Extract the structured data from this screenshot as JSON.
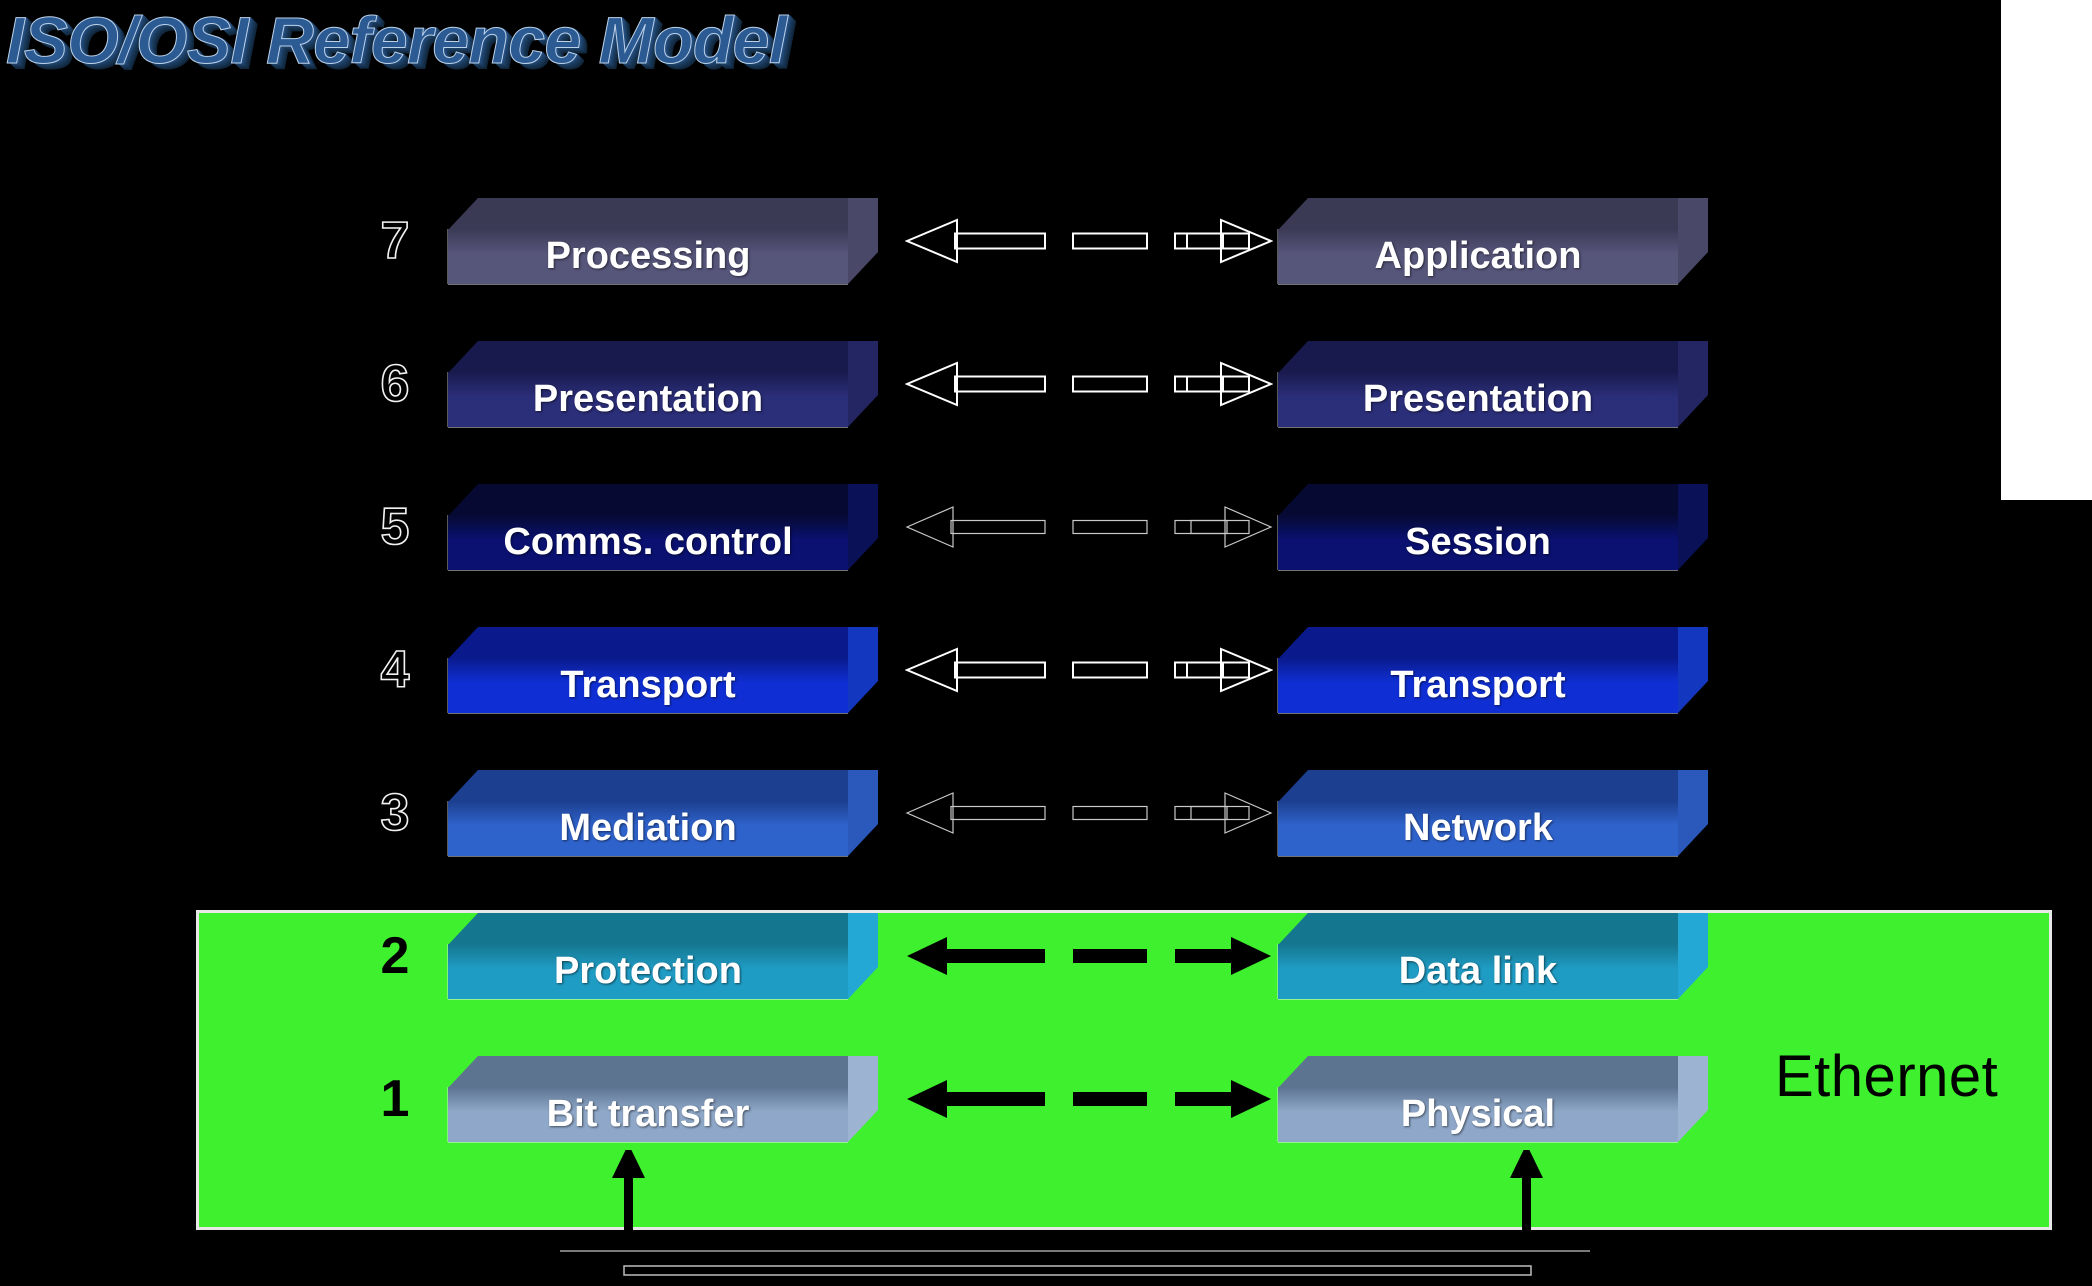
{
  "slide": {
    "title": "ISO/OSI Reference Model",
    "background_color": "#000000",
    "title_color": "#2c5a93"
  },
  "ethernet": {
    "label": "Ethernet",
    "band_color": "#3ef02d",
    "border_color": "#e8e8e8"
  },
  "layers": [
    {
      "number": "7",
      "left_label": "Processing",
      "right_label": "Application",
      "top_color": "#3b3a55",
      "front_color": "#56557a",
      "side_color": "#494869",
      "arrow_style": "outline-thick",
      "arrow_color": "#ffffff",
      "number_style": "outlined"
    },
    {
      "number": "6",
      "left_label": "Presentation",
      "right_label": "Presentation",
      "top_color": "#181a4e",
      "front_color": "#2b2e78",
      "side_color": "#242663",
      "arrow_style": "outline-thick",
      "arrow_color": "#ffffff",
      "number_style": "outlined"
    },
    {
      "number": "5",
      "left_label": "Comms. control",
      "right_label": "Session",
      "top_color": "#060a33",
      "front_color": "#0a1170",
      "side_color": "#0b1157",
      "arrow_style": "outline-thin",
      "arrow_color": "#c9c9c9",
      "number_style": "outlined"
    },
    {
      "number": "4",
      "left_label": "Transport",
      "right_label": "Transport",
      "top_color": "#0a1a8c",
      "front_color": "#0f2fd4",
      "side_color": "#1437bf",
      "arrow_style": "outline-thick",
      "arrow_color": "#ffffff",
      "number_style": "outlined"
    },
    {
      "number": "3",
      "left_label": "Mediation",
      "right_label": "Network",
      "top_color": "#1c3f8f",
      "front_color": "#2f63cc",
      "side_color": "#2a58bb",
      "arrow_style": "outline-thin",
      "arrow_color": "#c9c9c9",
      "number_style": "outlined"
    },
    {
      "number": "2",
      "left_label": "Protection",
      "right_label": "Data link",
      "top_color": "#15768f",
      "front_color": "#1f9cc4",
      "side_color": "#23a8d6",
      "arrow_style": "solid",
      "arrow_color": "#000000",
      "number_style": "solid"
    },
    {
      "number": "1",
      "left_label": "Bit transfer",
      "right_label": "Physical",
      "top_color": "#5d7491",
      "front_color": "#8fa8c9",
      "side_color": "#9cb4d2",
      "arrow_style": "solid",
      "arrow_color": "#000000",
      "number_style": "solid"
    }
  ],
  "bottom_connector": {
    "color": "#000000",
    "outline_color": "#bdbdbd",
    "description": "u-shaped-link-between-physical-layers"
  }
}
